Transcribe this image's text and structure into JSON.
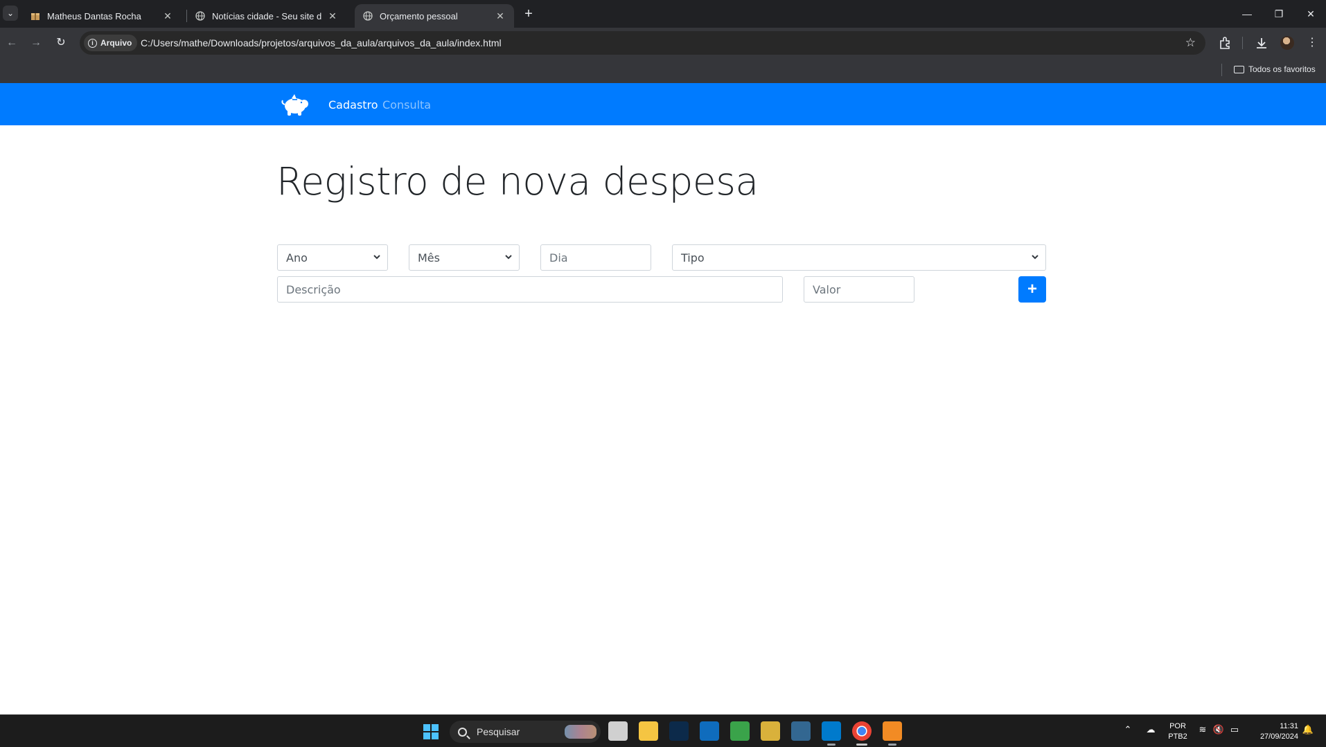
{
  "browser": {
    "tabs": [
      {
        "title": "Matheus Dantas Rocha",
        "active": false
      },
      {
        "title": "Notícias cidade - Seu site de no",
        "active": false
      },
      {
        "title": "Orçamento pessoal",
        "active": true
      }
    ],
    "security_chip": "Arquivo",
    "url": "C:/Users/mathe/Downloads/projetos/arquivos_da_aula/arquivos_da_aula/index.html",
    "bookmark_folder": "Todos os favoritos"
  },
  "page": {
    "nav": {
      "links": [
        {
          "label": "Cadastro",
          "active": true
        },
        {
          "label": "Consulta",
          "active": false
        }
      ]
    },
    "heading": "Registro de nova despesa",
    "form": {
      "ano": "Ano",
      "mes": "Mês",
      "dia_placeholder": "Dia",
      "tipo": "Tipo",
      "descricao_placeholder": "Descrição",
      "valor_placeholder": "Valor",
      "add_button": "+"
    },
    "colors": {
      "primary": "#007bff"
    }
  },
  "taskbar": {
    "search_placeholder": "Pesquisar",
    "language": "POR",
    "layout": "PTB2",
    "time": "11:31",
    "date": "27/09/2024"
  }
}
